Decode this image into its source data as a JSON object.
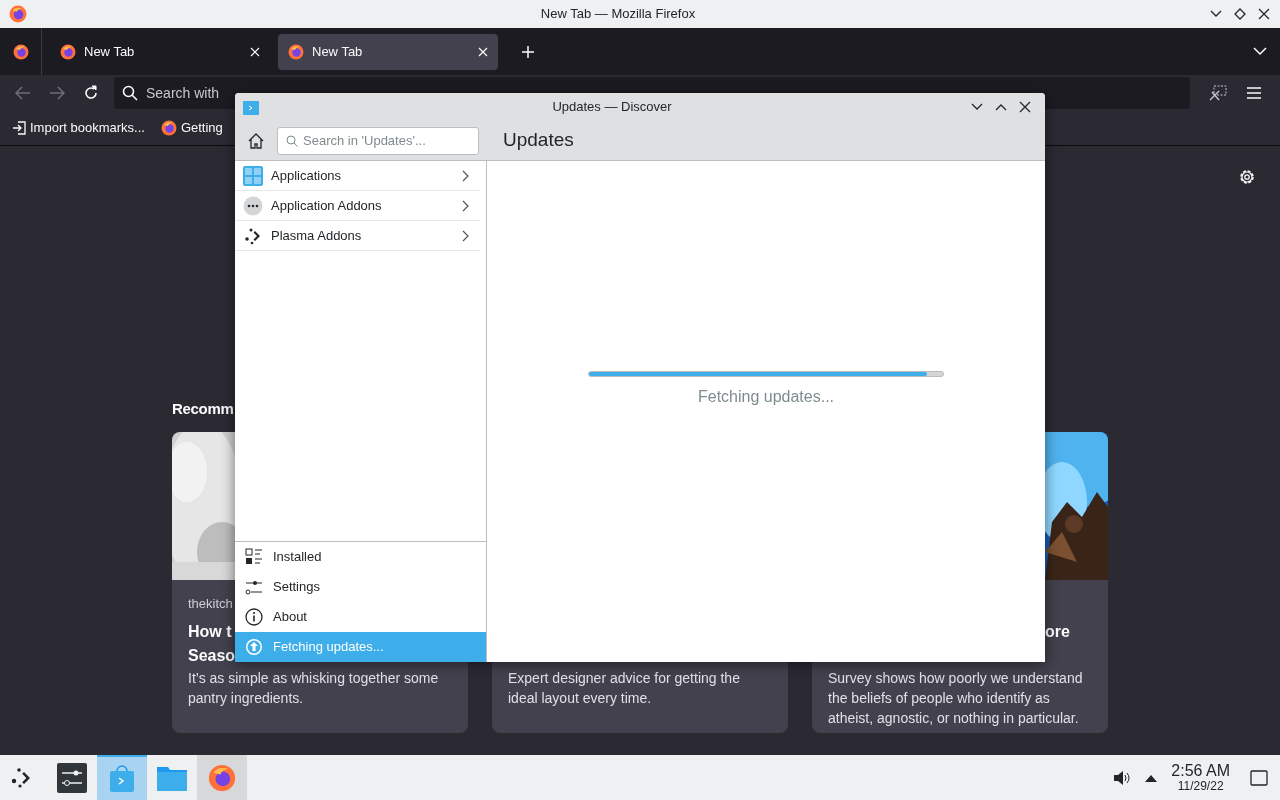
{
  "os_window": {
    "title": "New Tab — Mozilla Firefox"
  },
  "browser": {
    "tabs": [
      {
        "label": "New Tab",
        "selected": false
      },
      {
        "label": "New Tab",
        "selected": true
      }
    ],
    "address_bar": {
      "placeholder": "Search with"
    },
    "bookmarks": [
      {
        "label": "Import bookmarks...",
        "kind": "import"
      },
      {
        "label": "Getting",
        "kind": "page"
      }
    ],
    "section_heading": "Recomm",
    "cards": [
      {
        "source": "thekitch",
        "title_lines": [
          "How t",
          "Seaso"
        ],
        "excerpt": "It’s as simple as whisking together some pantry ingredients."
      },
      {
        "excerpt": "Expert designer advice for getting the ideal layout every time."
      },
      {
        "title_lines": [
          "ore"
        ],
        "excerpt": "Survey shows how poorly we understand the beliefs of people who identify as atheist, agnostic, or nothing in particular."
      }
    ]
  },
  "discover": {
    "title": "Updates — Discover",
    "search": {
      "placeholder": "Search in 'Updates'..."
    },
    "page_title": "Updates",
    "categories": [
      {
        "label": "Applications"
      },
      {
        "label": "Application Addons"
      },
      {
        "label": "Plasma Addons"
      }
    ],
    "bottom_items": [
      {
        "label": "Installed",
        "selected": false
      },
      {
        "label": "Settings",
        "selected": false
      },
      {
        "label": "About",
        "selected": false
      },
      {
        "label": "Fetching updates...",
        "selected": true
      }
    ],
    "progress": {
      "level": 0.955,
      "label": "Fetching updates..."
    }
  },
  "taskbar": {
    "apps": [
      {
        "kind": "launcher",
        "selected": false,
        "highlighted": false
      },
      {
        "kind": "settings",
        "selected": false,
        "highlighted": false
      },
      {
        "kind": "discover",
        "selected": true,
        "highlighted": false
      },
      {
        "kind": "files",
        "selected": false,
        "highlighted": false
      },
      {
        "kind": "firefox",
        "selected": false,
        "highlighted": true
      }
    ],
    "time": "2:56 AM",
    "date": "11/29/22"
  }
}
